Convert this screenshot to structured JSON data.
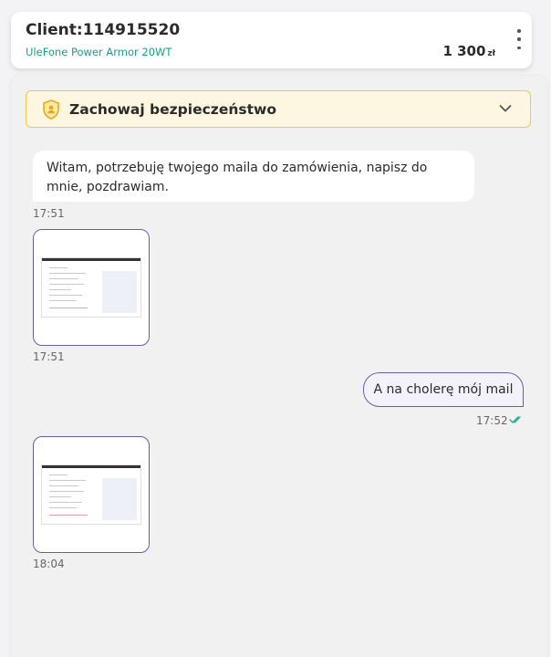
{
  "header": {
    "client_label": "Client:114915520",
    "product": "UleFone Power Armor 20WT",
    "price": "1 300",
    "currency": "zł",
    "menu_icon": "kebab-menu-icon"
  },
  "security": {
    "label": "Zachowaj bezpieczeństwo",
    "icon": "shield-user-icon",
    "toggle_icon": "chevron-down-icon"
  },
  "messages": [
    {
      "direction": "incoming",
      "type": "text",
      "text": "Witam, potrzebuję twojego maila do zamówienia, napisz do mnie, pozdrawiam.",
      "time": "17:51"
    },
    {
      "direction": "incoming",
      "type": "image",
      "time": "17:51"
    },
    {
      "direction": "outgoing",
      "type": "text",
      "text": "A na cholerę mój mail",
      "time": "17:52",
      "status_icon": "double-check-icon"
    },
    {
      "direction": "incoming",
      "type": "image",
      "time": "18:04"
    }
  ],
  "colors": {
    "accent": "#6c5ca8",
    "product_green": "#1a9f86",
    "warning_border": "#f3c647",
    "warning_bg": "#fdf6e0",
    "read_check": "#1fa893"
  }
}
